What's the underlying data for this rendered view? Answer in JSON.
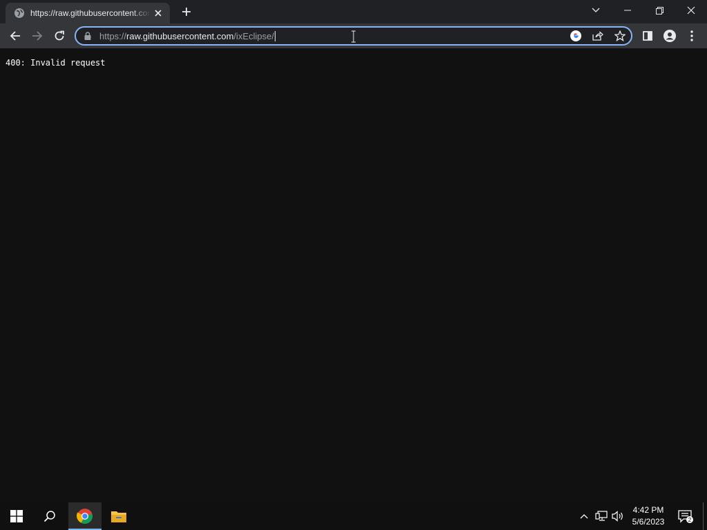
{
  "browser": {
    "tab": {
      "title": "https://raw.githubusercontent.com/ixEclipse/",
      "favicon": "globe-icon"
    },
    "omnibox": {
      "url_scheme": "https://",
      "url_host": "raw.githubusercontent.com",
      "url_path": "/ixEclipse/",
      "lock_icon": "lock-icon"
    },
    "accent_color": "#8ab4f8"
  },
  "page": {
    "body_text": "400: Invalid request"
  },
  "taskbar": {
    "time": "4:42 PM",
    "date": "5/6/2023",
    "notification_count": "2",
    "active_app": "chrome"
  }
}
